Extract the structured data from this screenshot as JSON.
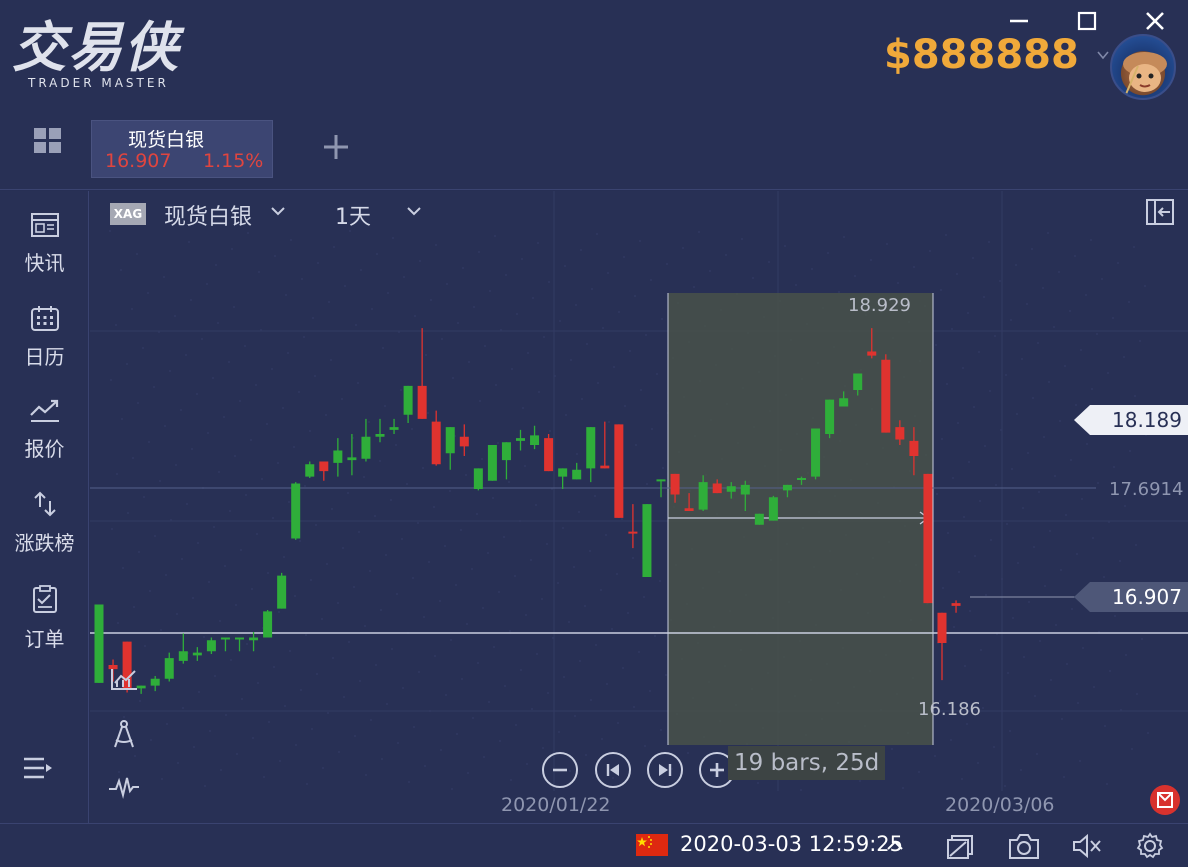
{
  "header": {
    "logo_cn": "交易侠",
    "logo_en": "TRADER MASTER",
    "balance": "$888888",
    "window_controls": [
      "minimize",
      "maximize",
      "close"
    ]
  },
  "tabs": [
    {
      "name": "现货白银",
      "price": "16.907",
      "change": "1.15%"
    }
  ],
  "sidebar": {
    "items": [
      {
        "label": "快讯",
        "icon": "news-icon"
      },
      {
        "label": "日历",
        "icon": "calendar-icon"
      },
      {
        "label": "报价",
        "icon": "quote-chart-icon"
      },
      {
        "label": "涨跌榜",
        "icon": "up-down-arrows-icon"
      },
      {
        "label": "订单",
        "icon": "order-clipboard-icon"
      }
    ]
  },
  "chart_header": {
    "symbol_badge": "XAG",
    "symbol_name": "现货白银",
    "timeframe": "1天"
  },
  "chart_data": {
    "type": "candlestick",
    "x_tick_labels": [
      "2020/01/22",
      "2020/03/06"
    ],
    "price_tags": {
      "upper": "18.189",
      "current": "16.907"
    },
    "reference_line_label": "17.6914",
    "range_high_label": "18.929",
    "range_low_label": "16.186",
    "selection_info": "19 bars, 25d",
    "ohlc": [
      [
        16.35,
        16.58,
        16.35,
        16.92
      ],
      [
        16.48,
        16.52,
        16.36,
        16.45
      ],
      [
        16.65,
        16.65,
        16.28,
        16.3
      ],
      [
        16.31,
        16.33,
        16.27,
        16.33
      ],
      [
        16.33,
        16.4,
        16.29,
        16.38
      ],
      [
        16.38,
        16.57,
        16.36,
        16.53
      ],
      [
        16.51,
        16.71,
        16.49,
        16.58
      ],
      [
        16.55,
        16.61,
        16.51,
        16.57
      ],
      [
        16.58,
        16.68,
        16.56,
        16.66
      ],
      [
        16.68,
        16.68,
        16.58,
        16.68
      ],
      [
        16.68,
        16.68,
        16.58,
        16.68
      ],
      [
        16.66,
        16.72,
        16.58,
        16.68
      ],
      [
        16.68,
        16.88,
        16.68,
        16.87
      ],
      [
        16.89,
        17.15,
        16.89,
        17.13
      ],
      [
        17.4,
        17.81,
        17.39,
        17.8
      ],
      [
        17.85,
        17.96,
        17.84,
        17.94
      ],
      [
        17.96,
        17.96,
        17.82,
        17.89
      ],
      [
        17.95,
        18.13,
        17.85,
        18.04
      ],
      [
        17.97,
        18.16,
        17.86,
        17.99
      ],
      [
        17.98,
        18.27,
        17.96,
        18.14
      ],
      [
        18.14,
        18.27,
        18.1,
        18.16
      ],
      [
        18.19,
        18.27,
        18.16,
        18.21
      ],
      [
        18.3,
        18.47,
        18.24,
        18.51
      ],
      [
        18.51,
        18.93,
        18.28,
        18.27
      ],
      [
        18.25,
        18.33,
        17.93,
        17.94
      ],
      [
        18.02,
        18.14,
        17.9,
        18.21
      ],
      [
        18.14,
        18.23,
        18.0,
        18.07
      ],
      [
        17.76,
        17.86,
        17.75,
        17.91
      ],
      [
        17.82,
        18.06,
        17.82,
        18.08
      ],
      [
        17.97,
        18.07,
        17.83,
        18.1
      ],
      [
        18.11,
        18.19,
        18.04,
        18.13
      ],
      [
        18.08,
        18.22,
        18.05,
        18.15
      ],
      [
        18.13,
        18.16,
        17.9,
        17.89
      ],
      [
        17.85,
        17.88,
        17.76,
        17.91
      ],
      [
        17.83,
        17.95,
        17.84,
        17.9
      ],
      [
        17.91,
        17.9,
        17.81,
        18.21
      ],
      [
        17.93,
        18.25,
        17.91,
        17.91
      ],
      [
        18.23,
        18.05,
        18.29,
        17.55
      ],
      [
        17.45,
        17.65,
        17.33,
        17.44
      ],
      [
        17.12,
        17.42,
        17.16,
        17.65
      ],
      [
        17.82,
        17.83,
        17.7,
        17.83
      ],
      [
        17.87,
        17.72,
        17.66,
        17.72
      ],
      [
        17.62,
        17.73,
        17.62,
        17.6
      ],
      [
        17.61,
        17.86,
        17.6,
        17.81
      ],
      [
        17.8,
        17.83,
        17.74,
        17.73
      ],
      [
        17.74,
        17.81,
        17.69,
        17.78
      ],
      [
        17.72,
        17.82,
        17.6,
        17.79
      ],
      [
        17.5,
        17.53,
        17.54,
        17.58
      ],
      [
        17.53,
        17.71,
        17.53,
        17.7
      ],
      [
        17.75,
        17.78,
        17.7,
        17.79
      ],
      [
        17.83,
        17.85,
        17.79,
        17.84
      ],
      [
        17.85,
        18.17,
        17.83,
        18.2
      ],
      [
        18.16,
        18.35,
        18.13,
        18.41
      ],
      [
        18.36,
        18.47,
        18.39,
        18.42
      ],
      [
        18.48,
        18.52,
        18.44,
        18.6
      ],
      [
        18.76,
        18.93,
        18.71,
        18.73
      ],
      [
        18.7,
        18.74,
        18.17,
        18.17
      ],
      [
        18.21,
        18.26,
        18.08,
        18.12
      ],
      [
        18.11,
        18.21,
        17.86,
        18.0
      ],
      [
        17.87,
        17.84,
        16.93,
        16.93
      ],
      [
        16.86,
        16.85,
        16.37,
        16.64
      ],
      [
        16.93,
        16.95,
        16.86,
        16.91
      ]
    ]
  },
  "chart_tools": [
    "indicator-icon",
    "drawing-compass-icon",
    "waveform-icon",
    "menu-expand-icon"
  ],
  "nav_buttons": [
    "zoom-out",
    "go-start",
    "go-end",
    "zoom-in"
  ],
  "footer": {
    "datetime": "2020-03-03 12:59:25",
    "icons": [
      "layers-icon",
      "camera-icon",
      "mute-icon",
      "settings-icon"
    ]
  },
  "colors": {
    "up": "#2fae3a",
    "down": "#e0332f",
    "balance": "#f0a93a",
    "background": "#283055"
  }
}
